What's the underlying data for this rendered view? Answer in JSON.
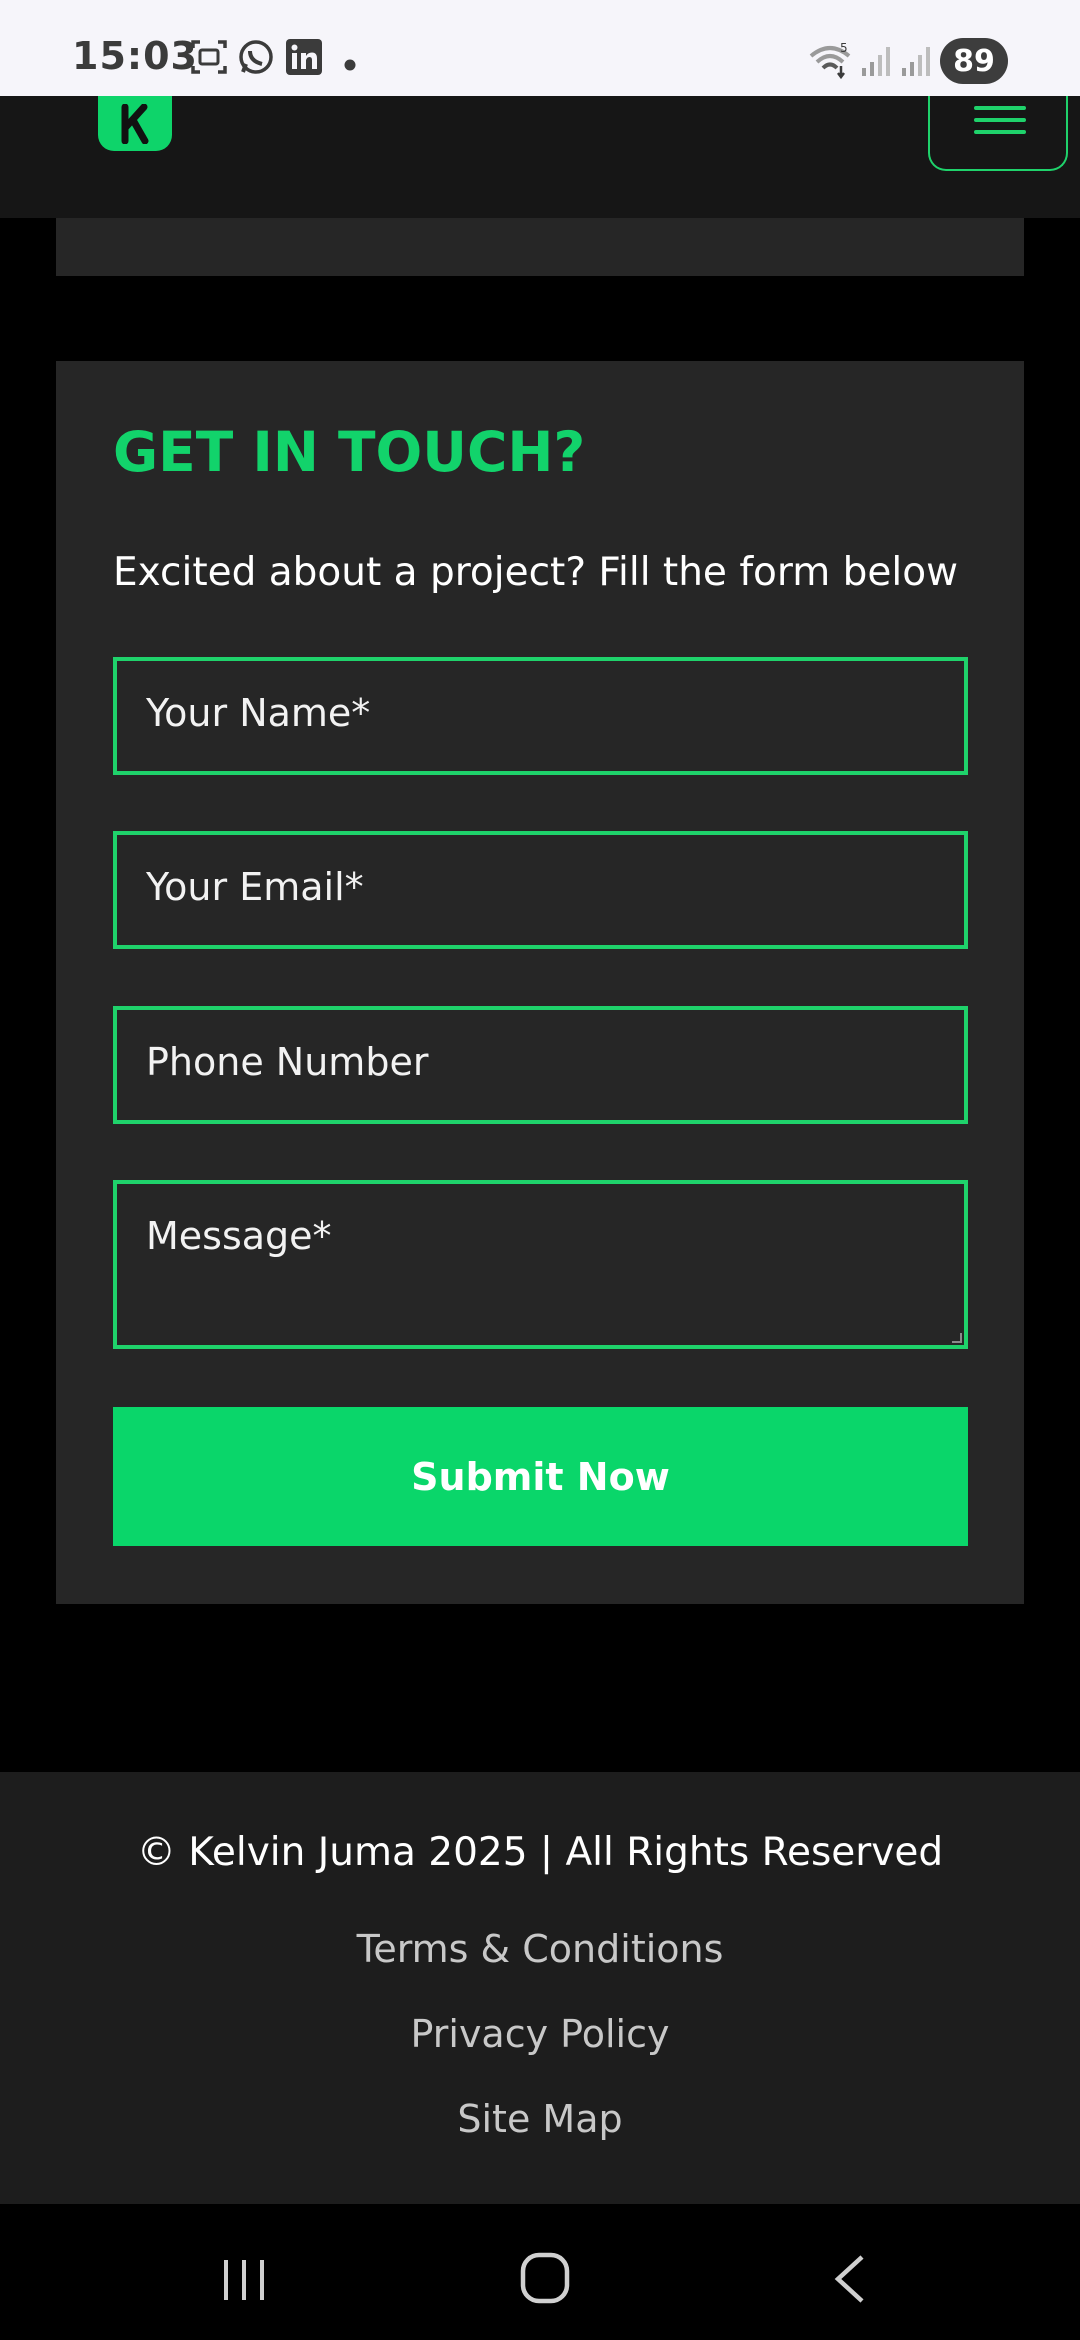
{
  "status_bar": {
    "time": "15:03",
    "battery": "89",
    "icons": [
      "screenshot-icon",
      "whatsapp-icon",
      "linkedin-icon",
      "notification-dot-icon",
      "wifi-icon",
      "signal-icon",
      "signal-icon"
    ]
  },
  "header": {
    "logo_letter": "K",
    "menu_icon": "hamburger-menu-icon"
  },
  "contact": {
    "title": "GET IN TOUCH?",
    "subtitle": "Excited about a project? Fill the form below",
    "fields": {
      "name_placeholder": "Your Name*",
      "email_placeholder": "Your Email*",
      "phone_placeholder": "Phone Number",
      "message_placeholder": "Message*"
    },
    "submit_label": "Submit Now"
  },
  "footer": {
    "copyright": "© Kelvin Juma 2025 | All Rights Reserved",
    "links": [
      "Terms & Conditions",
      "Privacy Policy",
      "Site Map"
    ]
  },
  "nav_bar": {
    "buttons": [
      "recent-apps-icon",
      "home-icon",
      "back-icon"
    ]
  },
  "colors": {
    "accent": "#0ad66a",
    "card": "#262626",
    "background": "#000000",
    "footer": "#1d1d1d"
  }
}
